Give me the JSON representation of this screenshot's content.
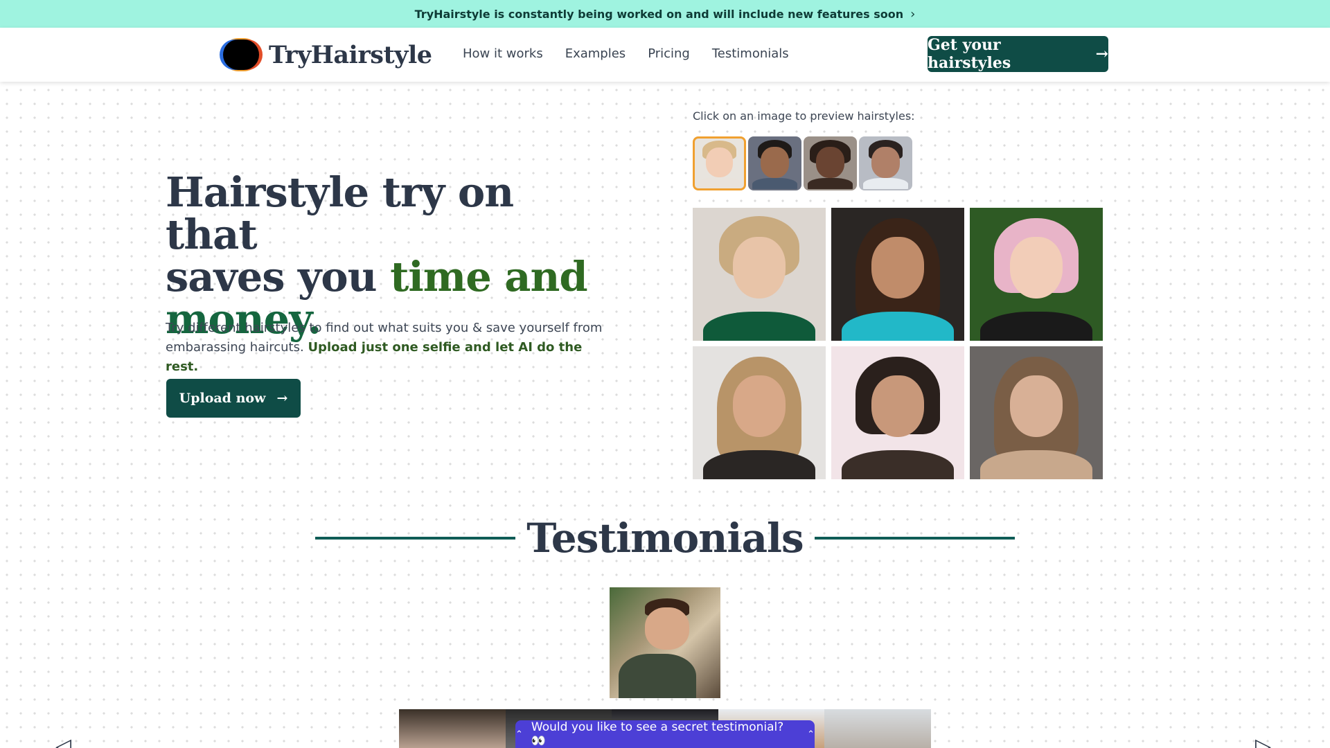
{
  "announcement": {
    "text": "TryHairstyle is constantly being worked on and will include new features soon",
    "chevron": "›"
  },
  "header": {
    "brand": "TryHairstyle",
    "nav": [
      "How it works",
      "Examples",
      "Pricing",
      "Testimonials"
    ],
    "cta_label": "Get your hairstyles",
    "cta_arrow": "→"
  },
  "hero": {
    "title_line1": "Hairstyle try on that",
    "title_line2_plain": "saves you ",
    "title_line2_accent": "time and",
    "title_line3_accent": "money.",
    "subtitle_plain": "Try different hairstyles to find out what suits you & save yourself from embarassing haircuts. ",
    "subtitle_strong": "Upload just one selfie and let AI do the rest.",
    "upload_label": "Upload now",
    "upload_arrow": "→"
  },
  "preview": {
    "label": "Click on an image to preview hairstyles:"
  },
  "testimonials": {
    "title": "Testimonials"
  },
  "carousel": {
    "prev_icon": "◁",
    "next_icon": "▷"
  },
  "secret_bar": {
    "text": "Would you like to see a secret testimonial? 👀",
    "icon": "⌃"
  },
  "colors": {
    "brand": "#0f4c46",
    "accent_green": "#2f6a22",
    "announce_bg": "#9ff3e0",
    "secret_bg": "#4c3fd6"
  }
}
